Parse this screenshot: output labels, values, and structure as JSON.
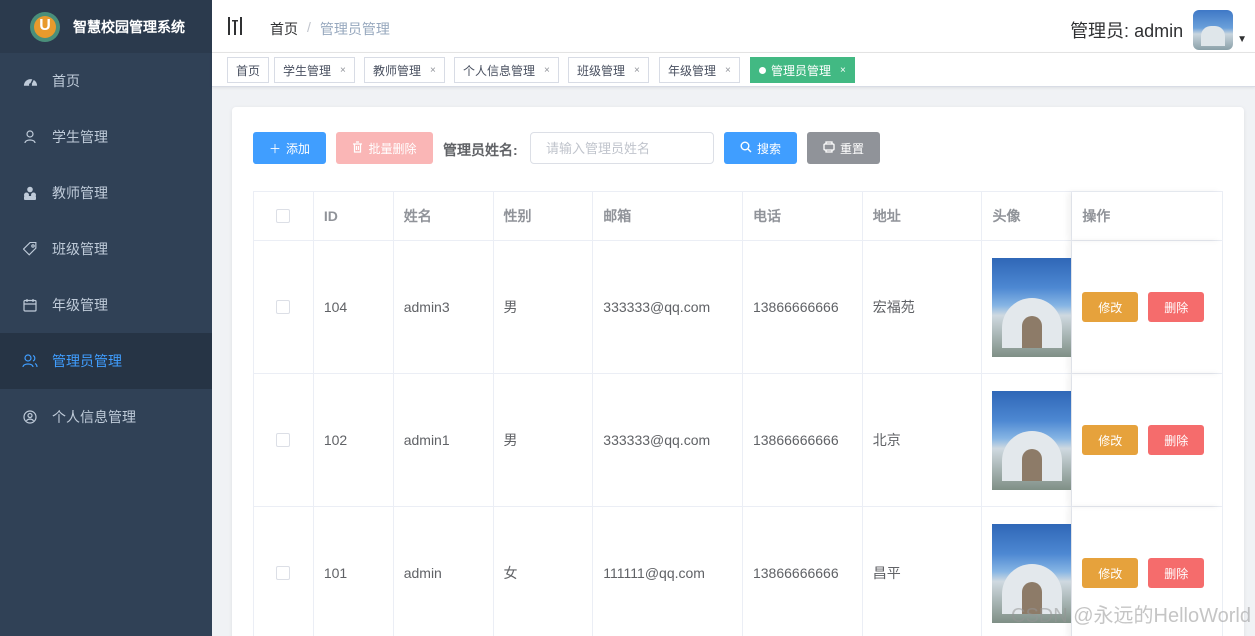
{
  "app": {
    "title": "智慧校园管理系统"
  },
  "sidebar": {
    "items": [
      {
        "label": "首页",
        "icon": "dashboard-icon",
        "active": false
      },
      {
        "label": "学生管理",
        "icon": "user-icon",
        "active": false
      },
      {
        "label": "教师管理",
        "icon": "peoples-icon",
        "active": false
      },
      {
        "label": "班级管理",
        "icon": "tag-icon",
        "active": false
      },
      {
        "label": "年级管理",
        "icon": "calendar-icon",
        "active": false
      },
      {
        "label": "管理员管理",
        "icon": "admin-icon",
        "active": true
      },
      {
        "label": "个人信息管理",
        "icon": "profile-icon",
        "active": false
      }
    ]
  },
  "header": {
    "breadcrumb": {
      "home": "首页",
      "separator": "/",
      "current": "管理员管理"
    },
    "user_label": "管理员: admin"
  },
  "tags": [
    {
      "label": "首页",
      "closable": false
    },
    {
      "label": "学生管理",
      "closable": true
    },
    {
      "label": "教师管理",
      "closable": true
    },
    {
      "label": "个人信息管理",
      "closable": true
    },
    {
      "label": "班级管理",
      "closable": true
    },
    {
      "label": "年级管理",
      "closable": true
    },
    {
      "label": "管理员管理",
      "closable": true,
      "active": true
    }
  ],
  "toolbar": {
    "add_label": "添加",
    "batch_delete_label": "批量删除",
    "search_label": "管理员姓名:",
    "search_placeholder": "请输入管理员姓名",
    "search_button": "搜索",
    "reset_button": "重置"
  },
  "table": {
    "columns": [
      "ID",
      "姓名",
      "性别",
      "邮箱",
      "电话",
      "地址",
      "头像",
      "操作"
    ],
    "rows": [
      {
        "id": "104",
        "name": "admin3",
        "sex": "男",
        "email": "333333@qq.com",
        "phone": "13866666666",
        "address": "宏福苑"
      },
      {
        "id": "102",
        "name": "admin1",
        "sex": "男",
        "email": "333333@qq.com",
        "phone": "13866666666",
        "address": "北京"
      },
      {
        "id": "101",
        "name": "admin",
        "sex": "女",
        "email": "111111@qq.com",
        "phone": "13866666666",
        "address": "昌平"
      }
    ],
    "edit_label": "修改",
    "delete_label": "删除"
  },
  "watermark": "CSDN @永远的HelloWorld",
  "colors": {
    "sidebar_bg": "#304156",
    "active_tag": "#42b983",
    "primary": "#409eff",
    "warning": "#e6a23c",
    "danger": "#f56c6c"
  }
}
